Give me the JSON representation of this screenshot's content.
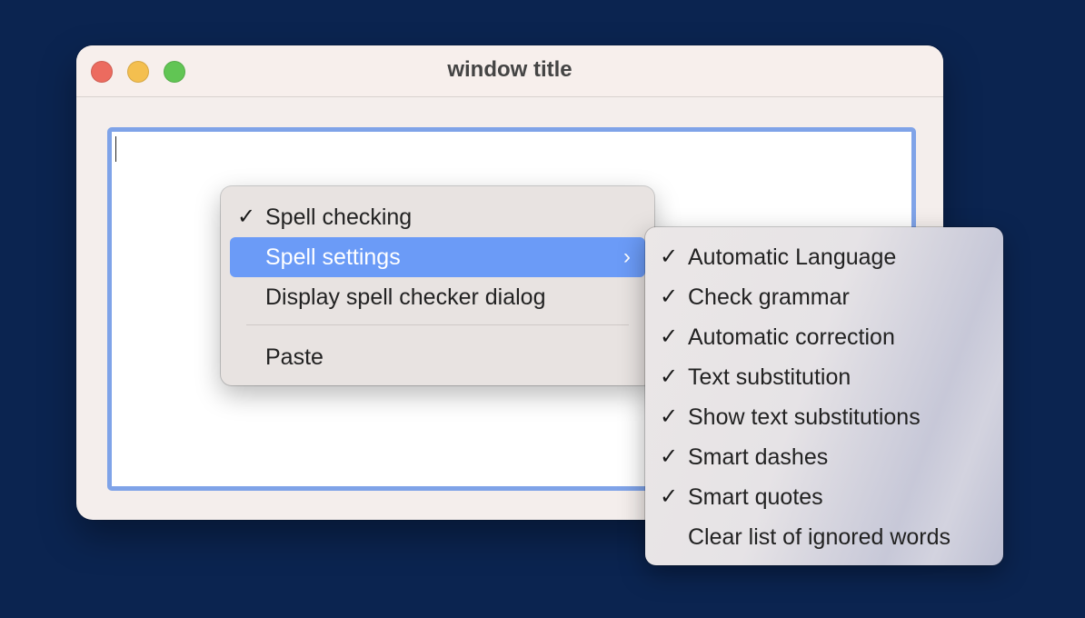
{
  "window": {
    "title": "window title"
  },
  "context_menu": {
    "items": [
      {
        "label": "Spell checking",
        "checked": true
      },
      {
        "label": "Spell settings",
        "highlighted": true,
        "has_submenu": true
      },
      {
        "label": "Display spell checker dialog"
      },
      {
        "label": "Paste"
      }
    ]
  },
  "submenu": {
    "items": [
      {
        "label": "Automatic Language",
        "checked": true
      },
      {
        "label": "Check grammar",
        "checked": true
      },
      {
        "label": "Automatic correction",
        "checked": true
      },
      {
        "label": "Text substitution",
        "checked": true
      },
      {
        "label": "Show text substitutions",
        "checked": true
      },
      {
        "label": "Smart dashes",
        "checked": true
      },
      {
        "label": "Smart quotes",
        "checked": true
      },
      {
        "label": "Clear list of ignored words",
        "checked": false
      }
    ]
  },
  "icons": {
    "check": "✓",
    "chevron": "›"
  },
  "colors": {
    "desktop": "#0b2450",
    "accent": "#6b9bf7",
    "focus_ring": "#7fa3e8"
  }
}
